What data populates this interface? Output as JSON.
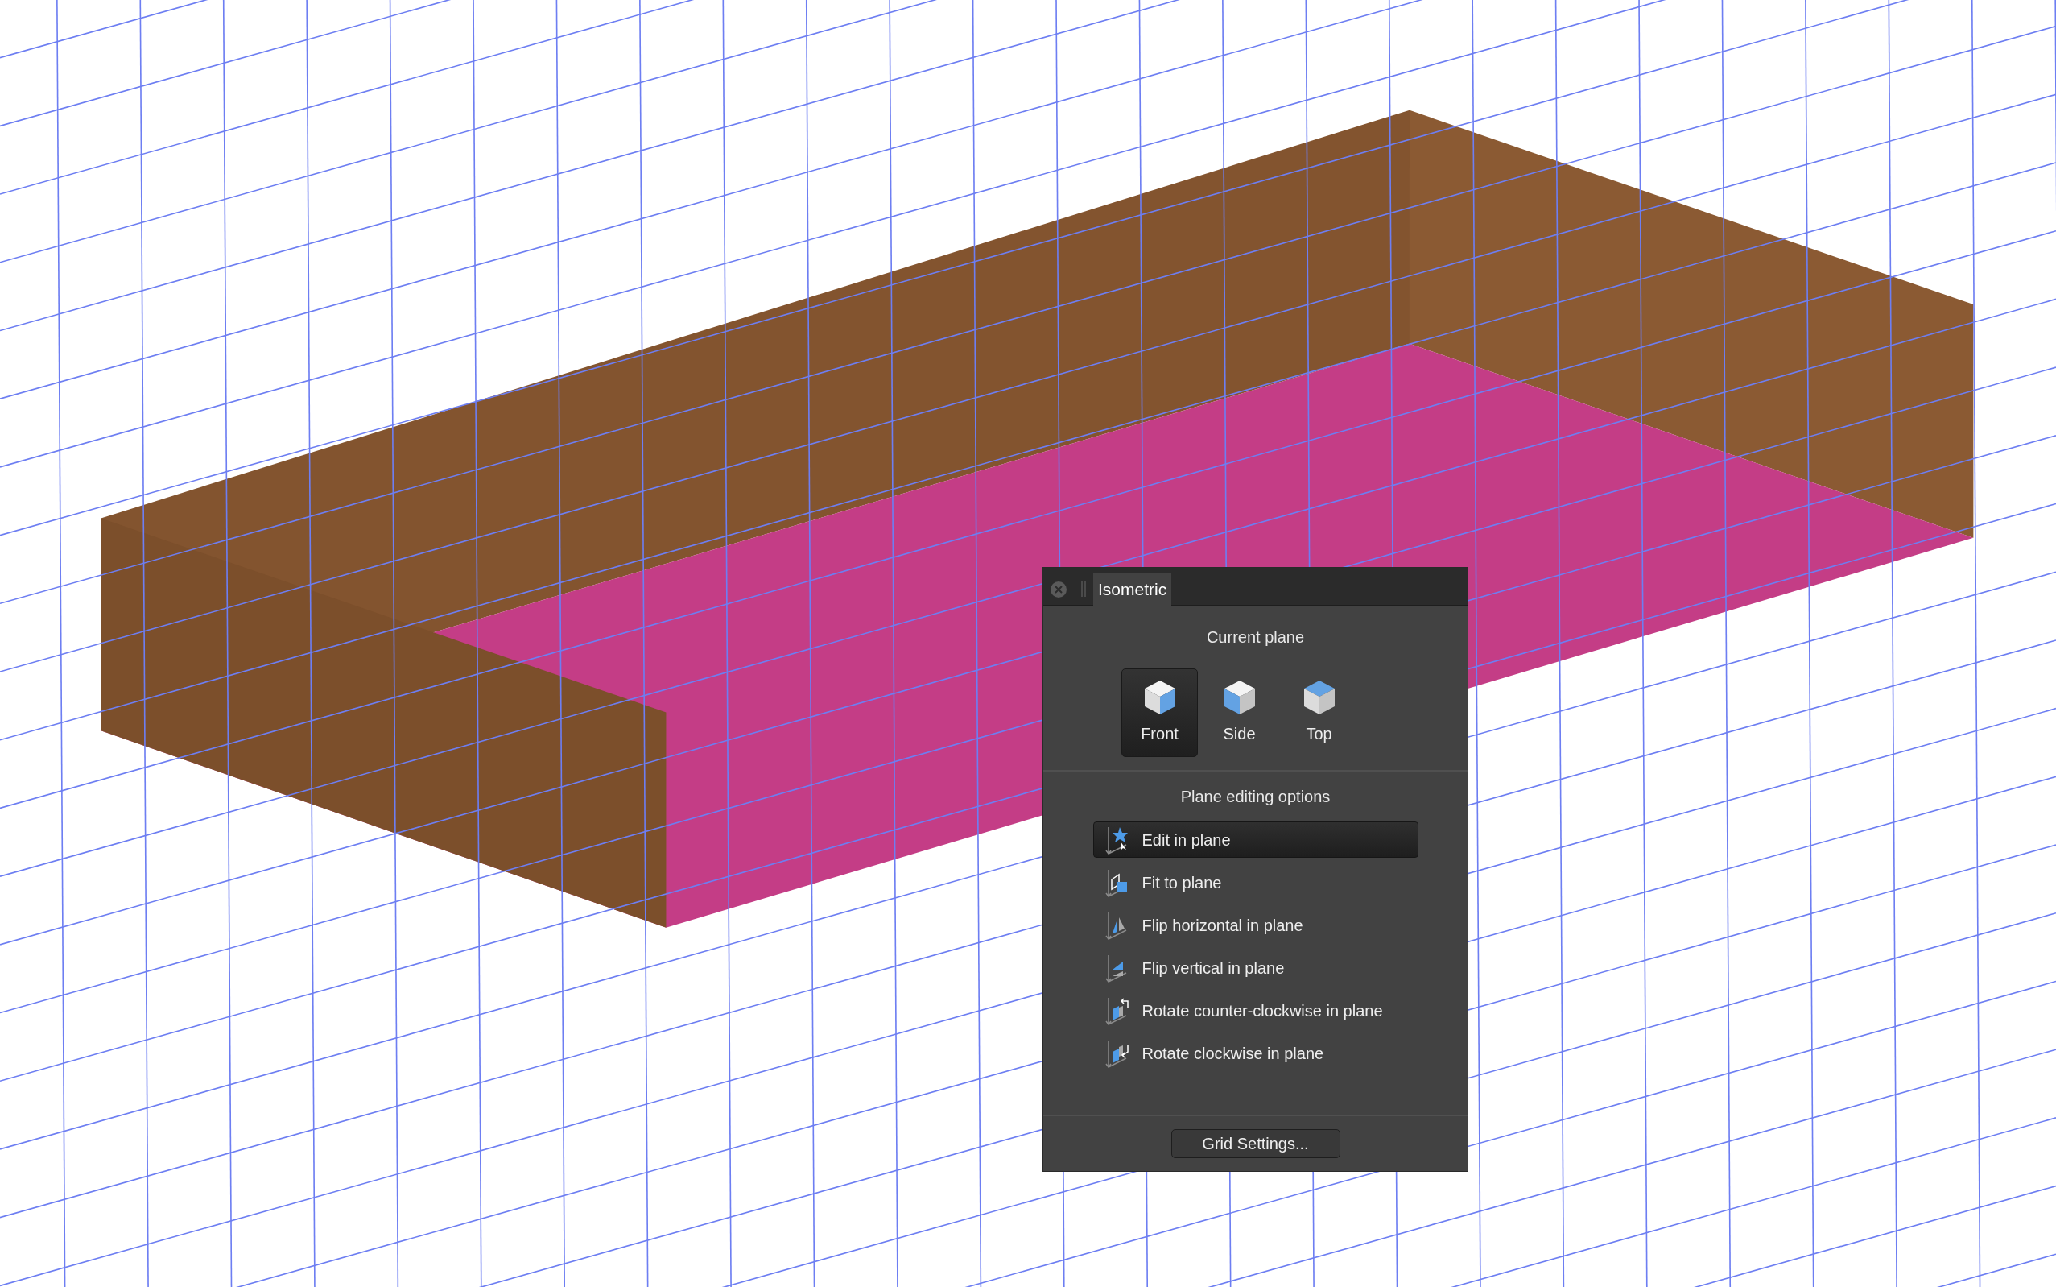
{
  "panel": {
    "tab": "Isometric",
    "current_plane_title": "Current plane",
    "planes": [
      {
        "label": "Front",
        "selected": true
      },
      {
        "label": "Side",
        "selected": false
      },
      {
        "label": "Top",
        "selected": false
      }
    ],
    "editing_title": "Plane editing options",
    "options": [
      {
        "label": "Edit in plane",
        "selected": true
      },
      {
        "label": "Fit to plane",
        "selected": false
      },
      {
        "label": "Flip horizontal in plane",
        "selected": false
      },
      {
        "label": "Flip vertical in plane",
        "selected": false
      },
      {
        "label": "Rotate counter-clockwise in plane",
        "selected": false
      },
      {
        "label": "Rotate clockwise in plane",
        "selected": false
      }
    ],
    "button": "Grid Settings..."
  }
}
